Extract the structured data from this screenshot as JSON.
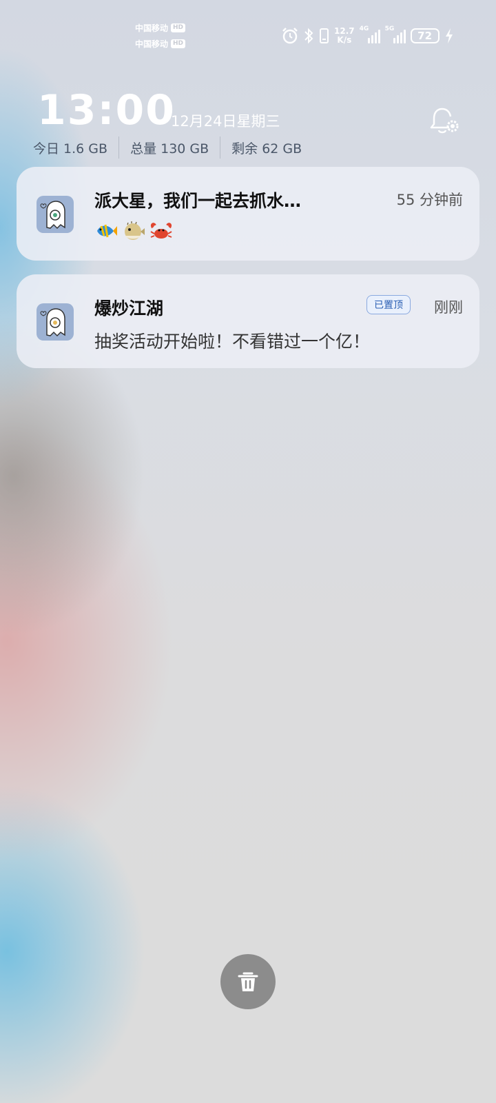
{
  "status_bar": {
    "carrier1": "中国移动",
    "carrier2": "中国移动",
    "hd_label": "HD",
    "net_speed_value": "12.7",
    "net_speed_unit": "K/s",
    "network1": "4G",
    "network2": "5G",
    "battery_level": "72",
    "icons": [
      "alarm-icon",
      "bluetooth-icon",
      "phone-vibrate-icon",
      "signal-icon",
      "signal-icon",
      "battery-icon",
      "charging-icon"
    ]
  },
  "header": {
    "time": "13:00",
    "date": "12月24日星期三",
    "storage": {
      "today": "今日 1.6 GB",
      "total": "总量 130 GB",
      "remaining": "剩余 62 GB"
    },
    "notification_settings_icon": "bell-settings-icon"
  },
  "notifications": [
    {
      "app_icon": "ghost-app-icon",
      "title": "派大星，我们一起去抓水…",
      "time": "55 分钟前",
      "body_emojis": [
        "tropical-fish-icon",
        "blowfish-icon",
        "crab-icon"
      ]
    },
    {
      "app_icon": "ghost-app-icon",
      "title": "爆炒江湖",
      "badge": "已置顶",
      "time": "刚刚",
      "body": "抽奖活动开始啦！不看错过一个亿！"
    }
  ],
  "actions": {
    "clear_all_icon": "trash-icon"
  },
  "colors": {
    "card_bg": "#eceef5",
    "badge_text": "#2b5fb3",
    "trash_bg": "#8c8c8c"
  }
}
